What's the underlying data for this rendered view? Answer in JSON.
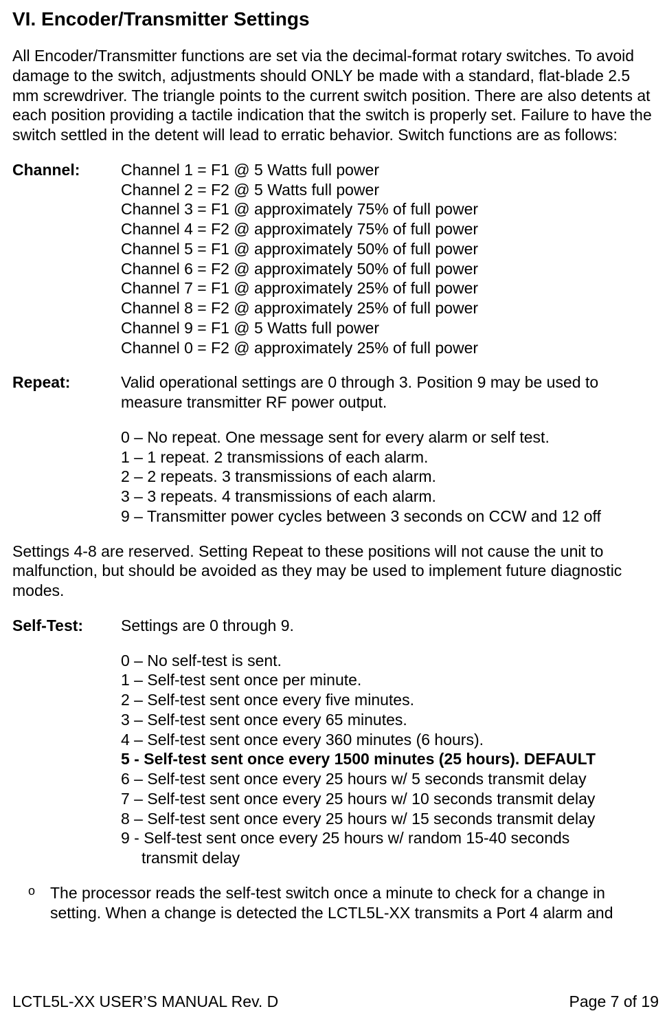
{
  "heading": "VI.    Encoder/Transmitter Settings",
  "intro": "All Encoder/Transmitter functions are set via the decimal-format rotary switches.  To avoid damage to the switch, adjustments should ONLY be made with a standard, flat-blade 2.5 mm screwdriver.  The triangle points to the current switch position.  There are also detents at each position providing a tactile indication that the switch is properly set.  Failure to have the switch settled in the detent will lead to erratic behavior.  Switch functions are as follows:",
  "channel_label": "Channel:",
  "channel_lines": {
    "0": "Channel 1 = F1 @ 5 Watts full power",
    "1": "Channel 2 = F2 @ 5 Watts full power",
    "2": "Channel 3 = F1 @ approximately 75% of full power",
    "3": "Channel 4 = F2 @ approximately 75% of full power",
    "4": "Channel 5 = F1 @ approximately 50% of full power",
    "5": "Channel 6 = F2 @ approximately 50% of full power",
    "6": "Channel 7 = F1 @ approximately 25% of full power",
    "7": "Channel 8 = F2 @ approximately 25% of full power",
    "8": "Channel 9 = F1 @ 5 Watts full power",
    "9": "Channel 0 = F2 @ approximately 25% of full power"
  },
  "repeat_label": "Repeat:",
  "repeat_intro": "Valid operational settings are 0 through 3.  Position 9 may be used to measure transmitter RF power output.",
  "repeat_lines": {
    "0": "0 – No repeat. One message sent for every alarm or self test.",
    "1": "1 – 1 repeat. 2 transmissions of each alarm.",
    "2": "2 – 2 repeats. 3 transmissions of each alarm.",
    "3": "3 – 3 repeats. 4 transmissions of each alarm.",
    "4": "9 – Transmitter power cycles between 3 seconds on CCW and 12 off"
  },
  "reserved": "Settings 4-8 are reserved. Setting Repeat to these positions will not cause the unit to malfunction, but should be avoided as they may be used to implement future diagnostic modes.",
  "selftest_label": "Self-Test:",
  "selftest_intro": "Settings are 0 through 9.",
  "selftest_lines": {
    "0": "0 – No self-test is sent.",
    "1": "1 – Self-test sent once per minute.",
    "2": "2 – Self-test sent once every five minutes.",
    "3": "3 – Self-test sent once every 65 minutes.",
    "4": "4 – Self-test sent once every 360 minutes (6 hours).",
    "5": "5 - Self-test sent once every 1500 minutes (25 hours). DEFAULT",
    "6": "6 – Self-test sent once every 25 hours w/ 5 seconds transmit delay",
    "7": "7 – Self-test sent once every 25 hours w/ 10 seconds transmit delay",
    "8": "8 – Self-test sent once every 25 hours w/ 15 seconds transmit delay",
    "9a": "9 - Self-test sent once every 25 hours w/ random 15-40 seconds",
    "9b": "transmit delay"
  },
  "bullet_mark": "o",
  "bullet_text": "The processor reads the self-test switch once a minute to check for a change in setting.  When a change is detected the LCTL5L-XX transmits a Port 4 alarm and",
  "footer_left": "LCTL5L-XX USER’S MANUAL Rev. D",
  "footer_right": "Page 7 of 19"
}
